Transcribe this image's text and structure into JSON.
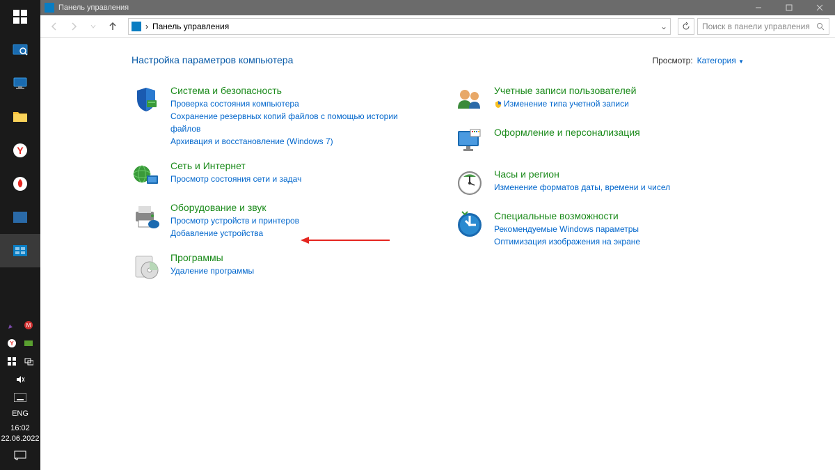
{
  "titlebar": {
    "title": "Панель управления"
  },
  "toolbar": {
    "breadcrumb_sep": "›",
    "breadcrumb": "Панель управления",
    "search_placeholder": "Поиск в панели управления"
  },
  "content": {
    "heading": "Настройка параметров компьютера",
    "view_label": "Просмотр:",
    "view_value": "Категория"
  },
  "cats_left": [
    {
      "title": "Система и безопасность",
      "links": [
        "Проверка состояния компьютера",
        "Сохранение резервных копий файлов с помощью истории файлов",
        "Архивация и восстановление (Windows 7)"
      ]
    },
    {
      "title": "Сеть и Интернет",
      "links": [
        "Просмотр состояния сети и задач"
      ]
    },
    {
      "title": "Оборудование и звук",
      "links": [
        "Просмотр устройств и принтеров",
        "Добавление устройства"
      ]
    },
    {
      "title": "Программы",
      "links": [
        "Удаление программы"
      ]
    }
  ],
  "cats_right": [
    {
      "title": "Учетные записи пользователей",
      "shield": true,
      "links": [
        "Изменение типа учетной записи"
      ]
    },
    {
      "title": "Оформление и персонализация",
      "links": []
    },
    {
      "title": "Часы и регион",
      "links": [
        "Изменение форматов даты, времени и чисел"
      ]
    },
    {
      "title": "Специальные возможности",
      "links": [
        "Рекомендуемые Windows параметры",
        "Оптимизация изображения на экране"
      ]
    }
  ],
  "taskbar": {
    "lang": "ENG",
    "time": "16:02",
    "date": "22.06.2022"
  }
}
